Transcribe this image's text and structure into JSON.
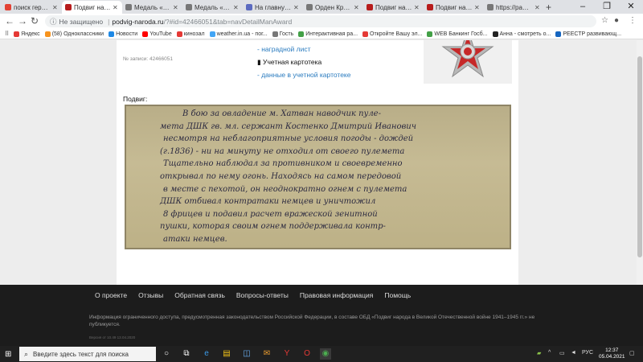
{
  "tabs": [
    {
      "title": "поиск героев по",
      "color": "#e34234"
    },
    {
      "title": "Подвиг народа",
      "color": "#b71c1c"
    },
    {
      "title": "Медаль «За от",
      "color": "#777777"
    },
    {
      "title": "Медаль «За от",
      "color": "#777777"
    },
    {
      "title": "На главную стр",
      "color": "#5c6bc0"
    },
    {
      "title": "Орден Красной",
      "color": "#777777"
    },
    {
      "title": "Подвиг народа",
      "color": "#b71c1c"
    },
    {
      "title": "Подвиг народа",
      "color": "#b71c1c"
    },
    {
      "title": "https://pamyat-",
      "color": "#777777"
    }
  ],
  "omnibox": {
    "security": "Не защищено",
    "host": "podvig-naroda.ru",
    "path": "/?#id=42466051&tab=navDetailManAward"
  },
  "bookmarks": [
    {
      "label": "Яндекс",
      "color": "#e53935"
    },
    {
      "label": "(58) Одноклассники",
      "color": "#f7931e"
    },
    {
      "label": "Новости",
      "color": "#1e88e5"
    },
    {
      "label": "YouTube",
      "color": "#ff0000"
    },
    {
      "label": "кинозал",
      "color": "#e53935"
    },
    {
      "label": "weather.in.ua - пог...",
      "color": "#42a5f5"
    },
    {
      "label": "Гость",
      "color": "#777777"
    },
    {
      "label": "Интерактивная ра...",
      "color": "#43a047"
    },
    {
      "label": "Откройте Вашу эл...",
      "color": "#e53935"
    },
    {
      "label": "WEB Банкинг Госб...",
      "color": "#43a047"
    },
    {
      "label": "Анна - смотреть о...",
      "color": "#222222"
    },
    {
      "label": "РЕЕСТР развивающ...",
      "color": "#1565c0"
    }
  ],
  "record": {
    "label": "№ записи:",
    "number": "42466051"
  },
  "links": {
    "award_sheet": "- наградной лист",
    "card": "Учетная картотека",
    "card_data": "- данные в учетной картотеке"
  },
  "podvig_label": "Подвиг:",
  "handwriting": [
    "В бою за овладение м. Хатван наводчик пуле-",
    "мета ДШК гв. мл. сержант Костенко Дмитрий Иванович",
    "несмотря на неблагоприятные условия погоды - дождей",
    "(г.1836) - ни на минуту не отходил от своего пулемета",
    "Тщательно наблюдал за противником и своевременно",
    "открывал по нему огонь. Находясь на самом передовой",
    "в месте с пехотой, он неоднократно огнем с пулемета",
    "ДШК отбивал контратаки немцев и уничтожил",
    "8 фрицев и подавил расчет вражеской зенитной",
    "пушки, которая своим огнем поддерживала контр-",
    "атаки немцев."
  ],
  "footer": {
    "nav": [
      "О проекте",
      "Отзывы",
      "Обратная связь",
      "Вопросы-ответы",
      "Правовая информация",
      "Помощь"
    ],
    "notice": "Информация ограниченного доступа, предусмотренная законодательством Российской Федерации, в составе ОБД «Подвиг народа в Великой Отечественной войне 1941–1945 гг.» не публикуется.",
    "version": "Версия от 10.49 13.04.2020"
  },
  "taskbar": {
    "search_placeholder": "Введите здесь текст для поиска",
    "lang": "РУС",
    "time": "12:37",
    "date": "05.04.2021"
  },
  "colors": {
    "link": "#2a7bbf",
    "footer_bg": "#1c1c1c",
    "scan_bg": "#c6bb94",
    "ink": "#2c2a40"
  }
}
